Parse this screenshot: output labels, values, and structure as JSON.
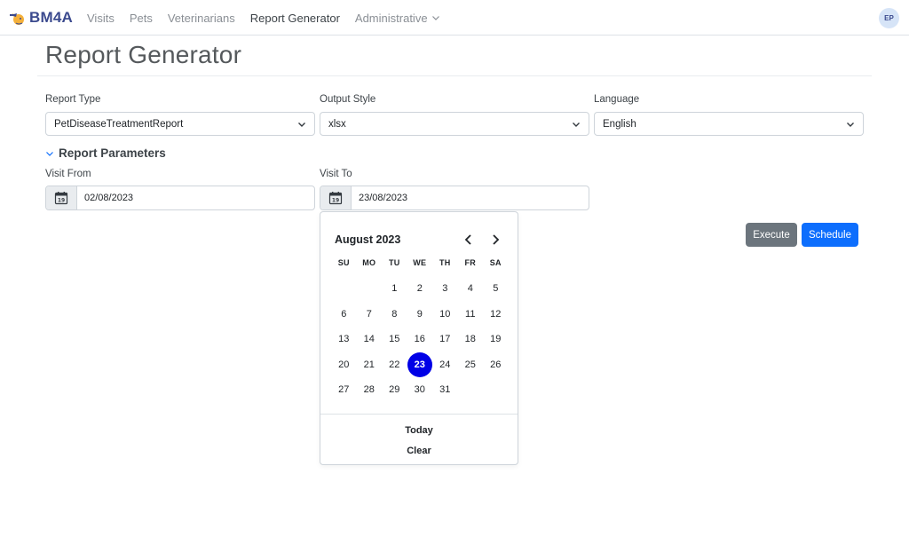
{
  "brand": {
    "name": "BM4A"
  },
  "nav": {
    "items": [
      "Visits",
      "Pets",
      "Veterinarians",
      "Report Generator",
      "Administrative"
    ],
    "active": "Report Generator"
  },
  "user": {
    "initials": "EP"
  },
  "page": {
    "title": "Report Generator"
  },
  "form": {
    "report_type": {
      "label": "Report Type",
      "value": "PetDiseaseTreatmentReport"
    },
    "output_style": {
      "label": "Output Style",
      "value": "xlsx"
    },
    "language": {
      "label": "Language",
      "value": "English"
    },
    "parameters_title": "Report Parameters",
    "visit_from": {
      "label": "Visit From",
      "value": "02/08/2023"
    },
    "visit_to": {
      "label": "Visit To",
      "value": "23/08/2023"
    }
  },
  "buttons": {
    "execute": "Execute",
    "schedule": "Schedule"
  },
  "calendar": {
    "month_label": "August 2023",
    "weekdays": [
      "SU",
      "MO",
      "TU",
      "WE",
      "TH",
      "FR",
      "SA"
    ],
    "first_weekday_index": 2,
    "days_in_month": 31,
    "selected_day": 23,
    "today_label": "Today",
    "clear_label": "Clear"
  },
  "colors": {
    "primary": "#0d6efd",
    "secondary": "#6c757d",
    "selected_day": "#0000e6",
    "brand": "#3b4a8e"
  },
  "icons": {
    "date_addon": "calendar-icon",
    "prev": "chevron-left-icon",
    "next": "chevron-right-icon",
    "dropdown": "chevron-down-icon"
  }
}
